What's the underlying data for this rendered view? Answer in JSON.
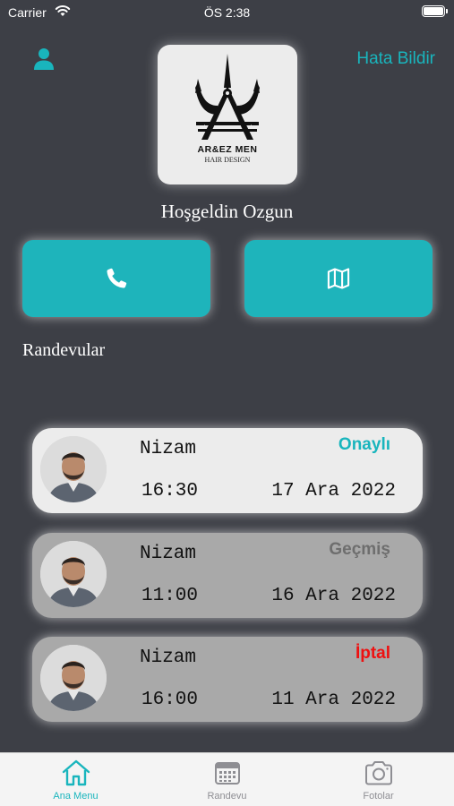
{
  "status_bar": {
    "carrier": "Carrier",
    "time": "ÖS 2:38"
  },
  "header": {
    "report_label": "Hata Bildir"
  },
  "logo": {
    "name": "AR&EZ MEN",
    "subtitle": "HAIR DESIGN"
  },
  "welcome": "Hoşgeldin Ozgun",
  "actions": {
    "call_icon": "phone-icon",
    "map_icon": "map-icon"
  },
  "section_title": "Randevular",
  "appointments": [
    {
      "name": "Nizam",
      "status": "Onaylı",
      "status_color": "#19b5bd",
      "time": "16:30",
      "date": "17 Ara 2022",
      "state": "active"
    },
    {
      "name": "Nizam",
      "status": "Geçmiş",
      "status_color": "#6e6e6e",
      "time": "11:00",
      "date": "16 Ara 2022",
      "state": "past"
    },
    {
      "name": "Nizam",
      "status": "İptal",
      "status_color": "#ee1111",
      "time": "16:00",
      "date": "11 Ara 2022",
      "state": "past"
    }
  ],
  "tabs": [
    {
      "label": "Ana Menu",
      "icon": "home-icon",
      "selected": true
    },
    {
      "label": "Randevu",
      "icon": "calendar-icon",
      "selected": false
    },
    {
      "label": "Fotolar",
      "icon": "camera-icon",
      "selected": false
    }
  ],
  "colors": {
    "accent": "#19b5bd",
    "background": "#3d3f46",
    "button": "#1eb4bb"
  }
}
